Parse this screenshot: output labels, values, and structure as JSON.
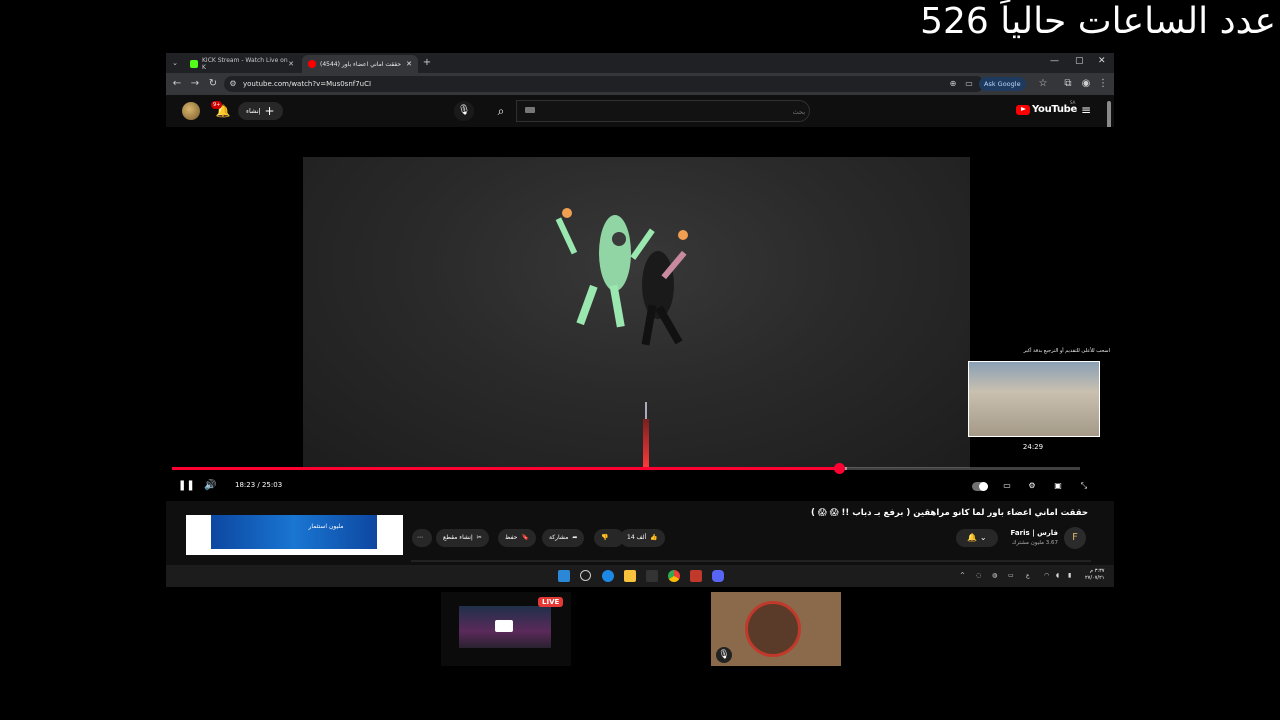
{
  "overlay": {
    "hours_text": "عدد الساعات حالياً 526"
  },
  "browser": {
    "tabs": [
      {
        "title": "KICK Stream - Watch Live on K",
        "active": false
      },
      {
        "title": "(4544) حققت اماني اعضاء باور",
        "active": true
      }
    ],
    "url": "youtube.com/watch?v=Mus0snf7uCI",
    "ask_google": "Ask Google"
  },
  "youtube": {
    "create_label": "إنشاء",
    "notifications_badge": "9+",
    "search_placeholder": "بحث",
    "logo_text": "YouTube",
    "region": "SA"
  },
  "player": {
    "current_time": "18:23",
    "duration": "25:03",
    "time_display": "18:23 / 25:03",
    "progress_fraction": 0.7345,
    "preview_hint": "اسحب للأعلى للتقديم أو الترجيع بدقة أكبر",
    "preview_time": "24:29"
  },
  "video": {
    "title": "حققت اماني اعضاء باور لما كانو مراهقين ( برفع بـ دباب !! 😱 😱 )",
    "channel_name": "فارس | Faris",
    "subscribers": "3.67 مليون مشترك",
    "likes_label": "14 ألف",
    "share_label": "مشاركة",
    "save_label": "حفظ",
    "clip_label": "إنشاء مقطع"
  },
  "ad": {
    "text": "مليون استثمار"
  },
  "taskbar": {
    "lang": "ع",
    "time": "٣:٣٧ م",
    "date": "٢٧/٠٧/٢١"
  },
  "cams": {
    "live_label": "LIVE"
  },
  "colors": {
    "accent": "#ff0033",
    "bg": "#0f0f0f"
  }
}
